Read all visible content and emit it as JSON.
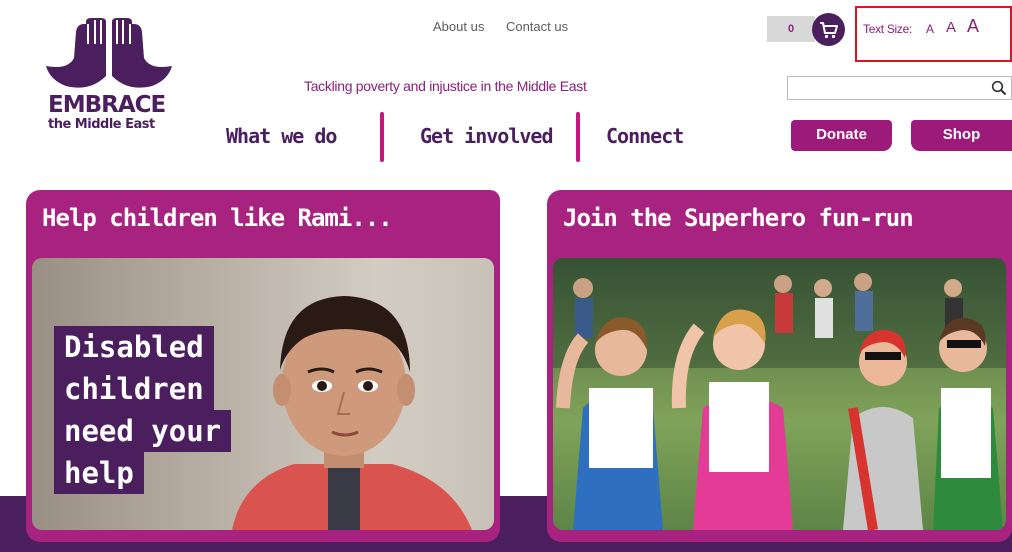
{
  "logo": {
    "name": "EMBRACE",
    "subtitle": "the Middle East"
  },
  "top_links": [
    "About us",
    "Contact us"
  ],
  "tagline": "Tackling poverty and injustice in the Middle East",
  "basket": {
    "count": "0",
    "icon": "shopping-cart-icon"
  },
  "text_size": {
    "label": "Text Size:",
    "small": "A",
    "medium": "A",
    "large": "A",
    "highlight_color": "#e2111d"
  },
  "search": {
    "value": "",
    "placeholder": "",
    "icon": "search-icon"
  },
  "nav": [
    "What we do",
    "Get involved",
    "Connect"
  ],
  "buttons": {
    "donate": "Donate",
    "shop": "Shop"
  },
  "panels": {
    "left": {
      "title": "Help children like Rami...",
      "overlay": [
        "Disabled",
        "children",
        "need your",
        "help"
      ]
    },
    "right": {
      "title": "Join the Superhero fun-run"
    }
  },
  "colors": {
    "brand_purple": "#4b1f5e",
    "brand_magenta": "#a8237f",
    "accent_pink": "#c8167f"
  }
}
